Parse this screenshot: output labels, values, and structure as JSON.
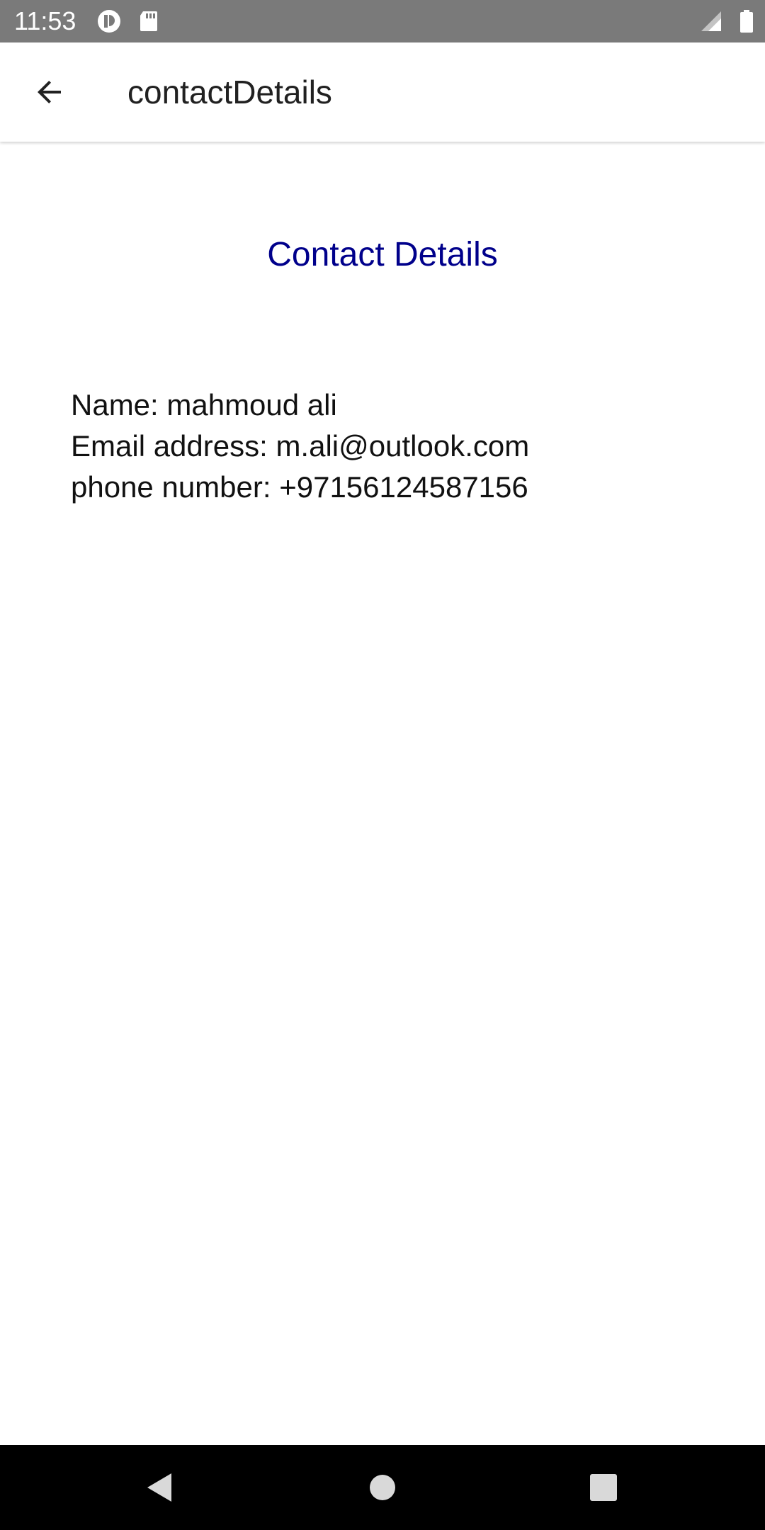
{
  "status_bar": {
    "time": "11:53",
    "icons": [
      "app-notification-icon",
      "sd-card-icon",
      "signal-icon",
      "battery-icon"
    ]
  },
  "app_bar": {
    "title": "contactDetails",
    "back_icon": "back-arrow-icon"
  },
  "content": {
    "heading": "Contact Details",
    "heading_color": "#00008b",
    "lines": [
      "Name: mahmoud ali",
      "Email address: m.ali@outlook.com",
      "phone number: +97156124587156"
    ]
  },
  "nav_bar": {
    "buttons": [
      "back-triangle-icon",
      "home-circle-icon",
      "recents-square-icon"
    ]
  }
}
